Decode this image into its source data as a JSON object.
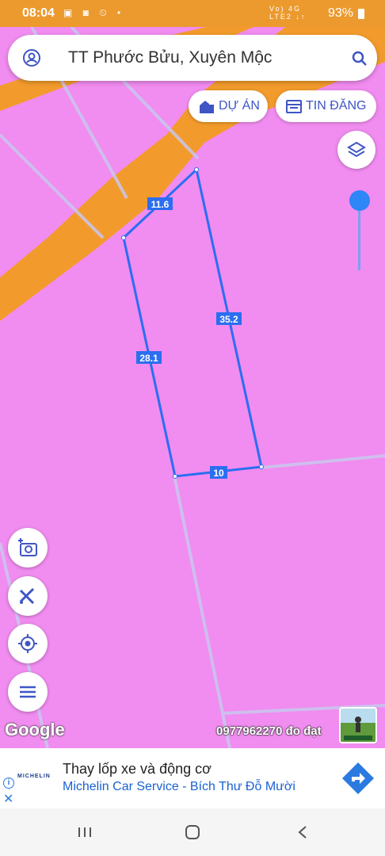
{
  "status_bar": {
    "time": "08:04",
    "left_icons": "▣ ◙ ⏲ •",
    "signal_text": "Vo) 4G\nLTE2 ↓↑",
    "battery": "93%"
  },
  "search": {
    "title": "TT Phước Bửu, Xuyên Mộc"
  },
  "actions": {
    "project_label": "DỰ ÁN",
    "listing_label": "TIN ĐĂNG"
  },
  "parcel": {
    "edges": [
      "11.6",
      "35.2",
      "28.1",
      "10"
    ]
  },
  "map": {
    "google_label": "Google",
    "credit": "0977962270 đo đạt"
  },
  "colors": {
    "land": "#f18cf0",
    "road": "#f29b2c",
    "parcel_outline": "#2b6ef0",
    "accent": "#3f55c4"
  },
  "ad": {
    "logo_text": "MICHELIN",
    "headline": "Thay lốp xe và động cơ",
    "sub": "Michelin Car Service - Bích Thư Đỗ Mười"
  }
}
